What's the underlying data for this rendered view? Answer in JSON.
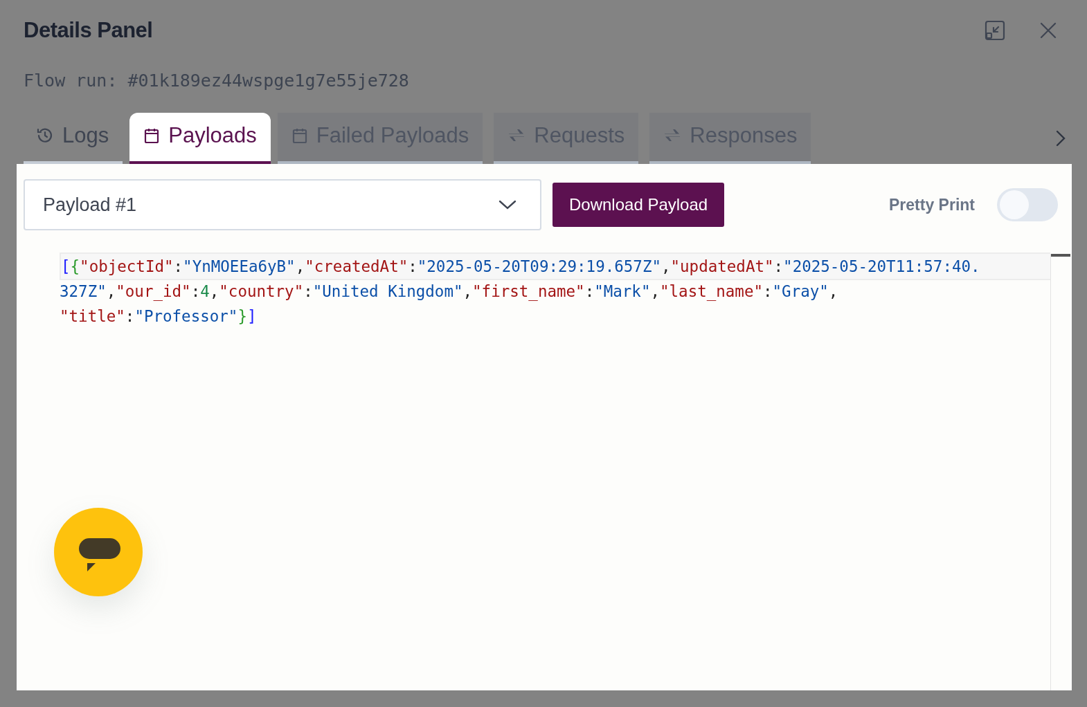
{
  "panel": {
    "title": "Details Panel",
    "subtitle": "Flow run: #01k189ez44wspge1g7e55je728"
  },
  "tabs": [
    {
      "label": "Logs",
      "kind": "history",
      "selected": false,
      "disabled": false
    },
    {
      "label": "Payloads",
      "kind": "payload",
      "selected": true,
      "disabled": false
    },
    {
      "label": "Failed Payloads",
      "kind": "payload",
      "selected": false,
      "disabled": true
    },
    {
      "label": "Requests",
      "kind": "transfer",
      "selected": false,
      "disabled": true
    },
    {
      "label": "Responses",
      "kind": "transfer",
      "selected": false,
      "disabled": true
    }
  ],
  "toolbar": {
    "payload_select": {
      "value": "Payload #1"
    },
    "download_button": "Download Payload",
    "pretty_print": {
      "label": "Pretty Print",
      "on": false
    }
  },
  "code_lines": [
    {
      "active": true,
      "tokens": [
        {
          "kind": "bracket",
          "text": "["
        },
        {
          "kind": "brace",
          "text": "{"
        },
        {
          "kind": "key",
          "text": "\"objectId\""
        },
        {
          "kind": "punct",
          "text": ":"
        },
        {
          "kind": "string",
          "text": "\"YnMOEEa6yB\""
        },
        {
          "kind": "punct",
          "text": ","
        },
        {
          "kind": "key",
          "text": "\"createdAt\""
        },
        {
          "kind": "punct",
          "text": ":"
        },
        {
          "kind": "string",
          "text": "\"2025-05-20T09:29:19.657Z\""
        },
        {
          "kind": "punct",
          "text": ","
        },
        {
          "kind": "key",
          "text": "\"updatedAt\""
        },
        {
          "kind": "punct",
          "text": ":"
        },
        {
          "kind": "string",
          "text": "\"2025-05-20T11:57:40."
        }
      ]
    },
    {
      "active": false,
      "tokens": [
        {
          "kind": "string",
          "text": "327Z\""
        },
        {
          "kind": "punct",
          "text": ","
        },
        {
          "kind": "key",
          "text": "\"our_id\""
        },
        {
          "kind": "punct",
          "text": ":"
        },
        {
          "kind": "number",
          "text": "4"
        },
        {
          "kind": "punct",
          "text": ","
        },
        {
          "kind": "key",
          "text": "\"country\""
        },
        {
          "kind": "punct",
          "text": ":"
        },
        {
          "kind": "string",
          "text": "\"United Kingdom\""
        },
        {
          "kind": "punct",
          "text": ","
        },
        {
          "kind": "key",
          "text": "\"first_name\""
        },
        {
          "kind": "punct",
          "text": ":"
        },
        {
          "kind": "string",
          "text": "\"Mark\""
        },
        {
          "kind": "punct",
          "text": ","
        },
        {
          "kind": "key",
          "text": "\"last_name\""
        },
        {
          "kind": "punct",
          "text": ":"
        },
        {
          "kind": "string",
          "text": "\"Gray\""
        },
        {
          "kind": "punct",
          "text": ","
        }
      ]
    },
    {
      "active": false,
      "tokens": [
        {
          "kind": "key",
          "text": "\"title\""
        },
        {
          "kind": "punct",
          "text": ":"
        },
        {
          "kind": "string",
          "text": "\"Professor\""
        },
        {
          "kind": "brace",
          "text": "}"
        },
        {
          "kind": "bracket",
          "text": "]"
        }
      ]
    }
  ]
}
